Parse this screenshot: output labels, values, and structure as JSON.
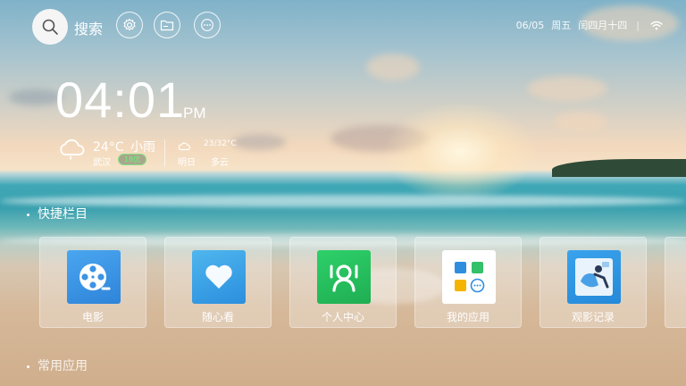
{
  "topbar": {
    "search_label": "搜索",
    "buttons": [
      "settings-icon",
      "folder-icon",
      "more-icon"
    ]
  },
  "status": {
    "date": "06/05",
    "weekday": "周五",
    "lunar": "闰四月十四",
    "separator": "|",
    "wifi_icon": "wifi-icon"
  },
  "clock": {
    "time": "04:01",
    "ampm": "PM"
  },
  "weather": {
    "today": {
      "temp": "24°C",
      "condition": "小雨",
      "city": "武汉",
      "aqi": "18优"
    },
    "tomorrow": {
      "temp_range": "23/32°C",
      "day": "明日",
      "condition": "多云"
    }
  },
  "sections": {
    "shortcuts": "快捷栏目",
    "common_apps": "常用应用"
  },
  "shortcuts": [
    {
      "label": "电影",
      "icon": "movie-reel-icon",
      "color": "#3d97e8"
    },
    {
      "label": "随心看",
      "icon": "heart-icon",
      "color": "#3aa6e6"
    },
    {
      "label": "个人中心",
      "icon": "person-icon",
      "color": "#22c25b"
    },
    {
      "label": "我的应用",
      "icon": "apps-grid-icon",
      "color": "#ffffff"
    },
    {
      "label": "观影记录",
      "icon": "watch-history-icon",
      "color": "#2f95e2"
    }
  ]
}
